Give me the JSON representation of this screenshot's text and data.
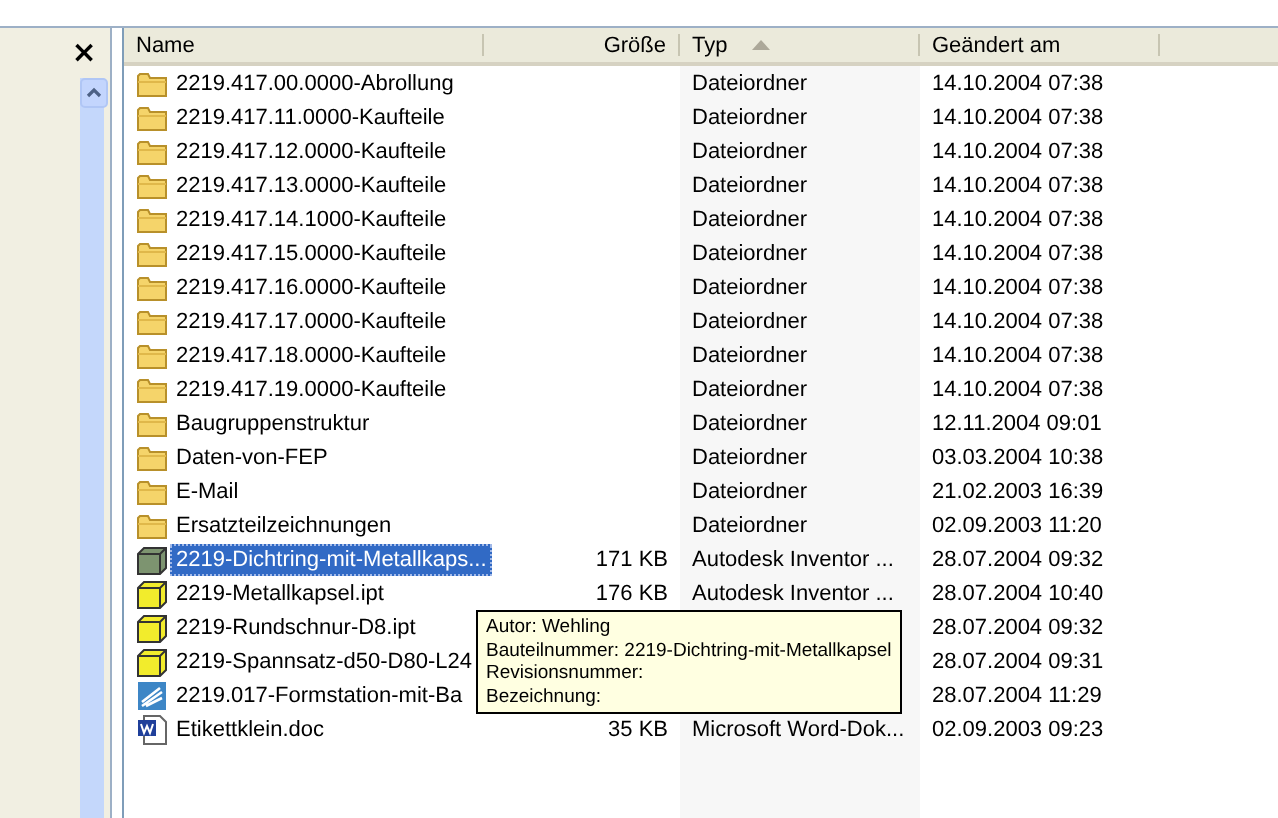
{
  "left_pane": {
    "close_glyph": "×"
  },
  "columns": [
    {
      "label": "Name",
      "sorted": false
    },
    {
      "label": "Größe",
      "sorted": false
    },
    {
      "label": "Typ",
      "sorted": true
    },
    {
      "label": "Geändert am",
      "sorted": false
    }
  ],
  "rows": [
    {
      "kind": "folder",
      "name": "2219.417.00.0000-Abrollung",
      "type": "Dateiordner",
      "modified": "14.10.2004 07:38",
      "selected": false
    },
    {
      "kind": "folder",
      "name": "2219.417.11.0000-Kaufteile",
      "type": "Dateiordner",
      "modified": "14.10.2004 07:38",
      "selected": false
    },
    {
      "kind": "folder",
      "name": "2219.417.12.0000-Kaufteile",
      "type": "Dateiordner",
      "modified": "14.10.2004 07:38",
      "selected": false
    },
    {
      "kind": "folder",
      "name": "2219.417.13.0000-Kaufteile",
      "type": "Dateiordner",
      "modified": "14.10.2004 07:38",
      "selected": false
    },
    {
      "kind": "folder",
      "name": "2219.417.14.1000-Kaufteile",
      "type": "Dateiordner",
      "modified": "14.10.2004 07:38",
      "selected": false
    },
    {
      "kind": "folder",
      "name": "2219.417.15.0000-Kaufteile",
      "type": "Dateiordner",
      "modified": "14.10.2004 07:38",
      "selected": false
    },
    {
      "kind": "folder",
      "name": "2219.417.16.0000-Kaufteile",
      "type": "Dateiordner",
      "modified": "14.10.2004 07:38",
      "selected": false
    },
    {
      "kind": "folder",
      "name": "2219.417.17.0000-Kaufteile",
      "type": "Dateiordner",
      "modified": "14.10.2004 07:38",
      "selected": false
    },
    {
      "kind": "folder",
      "name": "2219.417.18.0000-Kaufteile",
      "type": "Dateiordner",
      "modified": "14.10.2004 07:38",
      "selected": false
    },
    {
      "kind": "folder",
      "name": "2219.417.19.0000-Kaufteile",
      "type": "Dateiordner",
      "modified": "14.10.2004 07:38",
      "selected": false
    },
    {
      "kind": "folder",
      "name": "Baugruppenstruktur",
      "type": "Dateiordner",
      "modified": "12.11.2004 09:01",
      "selected": false
    },
    {
      "kind": "folder",
      "name": "Daten-von-FEP",
      "type": "Dateiordner",
      "modified": "03.03.2004 10:38",
      "selected": false
    },
    {
      "kind": "folder",
      "name": "E-Mail",
      "type": "Dateiordner",
      "modified": "21.02.2003 16:39",
      "selected": false
    },
    {
      "kind": "folder",
      "name": "Ersatzteilzeichnungen",
      "type": "Dateiordner",
      "modified": "02.09.2003 11:20",
      "selected": false
    },
    {
      "kind": "assembly",
      "name": "2219-Dichtring-mit-Metallkaps...",
      "size": "171 KB",
      "type": "Autodesk Inventor ...",
      "modified": "28.07.2004 09:32",
      "selected": true
    },
    {
      "kind": "part",
      "name": "2219-Metallkapsel.ipt",
      "size": "176 KB",
      "type": "Autodesk Inventor ...",
      "modified": "28.07.2004 10:40",
      "selected": false
    },
    {
      "kind": "part",
      "name": "2219-Rundschnur-D8.ipt",
      "modified": "28.07.2004 09:32",
      "selected": false
    },
    {
      "kind": "part",
      "name": "2219-Spannsatz-d50-D80-L24",
      "modified": "28.07.2004 09:31",
      "selected": false
    },
    {
      "kind": "drawing",
      "name": "2219.017-Formstation-mit-Ba",
      "modified": "28.07.2004 11:29",
      "selected": false
    },
    {
      "kind": "word",
      "name": "Etikettklein.doc",
      "size": "35 KB",
      "type": "Microsoft Word-Dok...",
      "modified": "02.09.2003 09:23",
      "selected": false
    }
  ],
  "tooltip": {
    "lines": [
      "Autor: Wehling",
      "Bauteilnummer: 2219-Dichtring-mit-Metallkapsel",
      "Revisionsnummer:",
      "Bezeichnung:"
    ]
  }
}
